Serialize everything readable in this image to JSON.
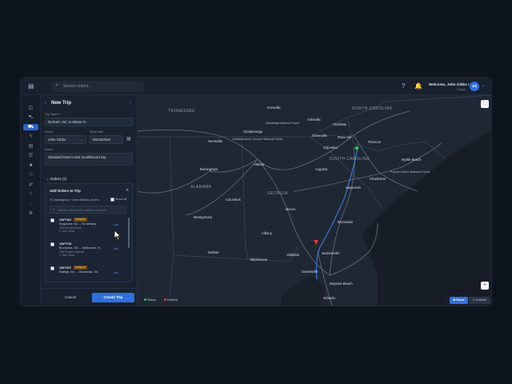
{
  "topbar": {
    "search_placeholder": "Search orders...",
    "welcome": "Welcome, John Gibbs !",
    "org": "Cargo",
    "avatar_initials": "JG"
  },
  "panel": {
    "title": "New Trip",
    "trip_name_label": "Trip Name *",
    "trip_name_value": "Durham, NC to Miami FL",
    "driver_label": "Driver",
    "driver_value": "John Gibbs",
    "start_date_label": "Start Date",
    "start_date_value": "08/16/2026",
    "notes_label": "Notes",
    "notes_value": "Standard East Coast southbound trip.",
    "orders_section": "Orders (1)",
    "add_orders": {
      "title": "Add Orders to Trip",
      "filter": "Unassigned + John Gibbs's orders",
      "show_all": "Show all",
      "search_placeholder": "Search orders by ID, address, vehicle..."
    },
    "orders": [
      {
        "id": "1DF7AV",
        "status": "Assigned",
        "route": "Kingsland, GA → No delivery",
        "vehicle": "2013 Honda Accord",
        "owner": "John Gibbs",
        "action": "Add"
      },
      {
        "id": "1DF7CD",
        "status": "",
        "route": "Brunswick, GA → Melbourne, FL",
        "vehicle": "2010 Subaru Outback",
        "owner": "John Gibbs",
        "action": "Add"
      },
      {
        "id": "1DF2DT",
        "status": "Assigned",
        "route": "Raleigh, NC → Brunswick, GA",
        "vehicle": "",
        "owner": "",
        "action": "Add"
      }
    ],
    "cancel_label": "Cancel",
    "create_label": "Create Trip"
  },
  "map": {
    "states": [
      "TENNESSEE",
      "NORTH CAROLINA",
      "SOUTH CAROLINA",
      "GEORGIA",
      "ALABAMA"
    ],
    "cities": {
      "charlotte": "Charlotte",
      "atlanta": "Atlanta",
      "columbia": "Columbia",
      "savannah": "Savannah",
      "jacksonville": "Jacksonville",
      "orlando": "Orlando",
      "montgomery": "Montgomery",
      "birmingham": "Birmingham",
      "chattanooga": "Chattanooga",
      "knoxville": "Knoxville",
      "asheville": "Asheville",
      "greenville": "Greenville",
      "augusta": "Augusta",
      "macon": "Macon",
      "huntsville": "Huntsville",
      "charleston": "Charleston",
      "florence": "Florence",
      "brunswick": "Brunswick",
      "gainesville": "Gainesville",
      "daytona": "Daytona Beach",
      "tallahassee": "Tallahassee",
      "columbus": "Columbus",
      "albany": "Albany",
      "valdosta": "Valdosta",
      "dothan": "Dothan",
      "myrtle": "Myrtle Beach",
      "rock_hill": "Rock Hill",
      "nantahala": "Nantahala National Forest",
      "chattahoochee": "Chattahoochee Oconee National Forest",
      "francis_marion": "Francis Marion National Forest"
    },
    "legend_pickup": "Pickup",
    "legend_delivery": "Delivery",
    "route_label": "Route",
    "drivers_label": "0 drivers",
    "colors": {
      "pickup": "#2fbf5a",
      "delivery": "#e0393e",
      "accent": "#2f6fe0"
    }
  }
}
